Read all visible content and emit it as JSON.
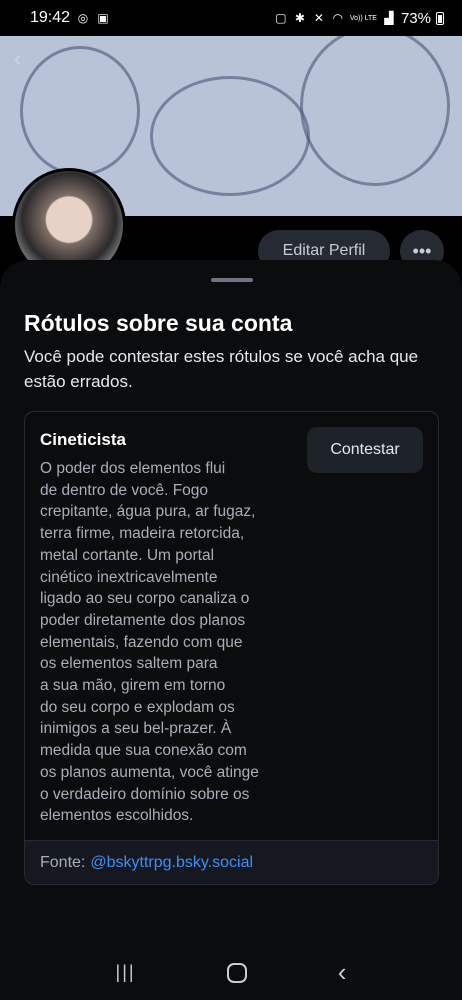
{
  "status_bar": {
    "time": "19:42",
    "icons_left": [
      "whatsapp-icon",
      "gallery-icon"
    ],
    "icons_right": [
      "nfc-icon",
      "bluetooth-icon",
      "mute-icon",
      "wifi-icon",
      "volte-icon",
      "signal-icon"
    ],
    "volte_label": "Vo)) LTE",
    "battery": "73%"
  },
  "profile": {
    "edit_button": "Editar Perfil",
    "more_icon": "•••"
  },
  "sheet": {
    "title": "Rótulos sobre sua conta",
    "subtitle": "Você pode contestar estes rótulos se você acha que estão errados.",
    "label": {
      "name": "Cineticista",
      "contest_button": "Contestar",
      "description": "O poder dos elementos flui\nde dentro de você. Fogo\ncrepitante, água pura, ar fugaz,\nterra firme, madeira retorcida,\nmetal cortante. Um portal\ncinético inextricavelmente\nligado ao seu corpo canaliza o\npoder diretamente dos planos\nelementais, fazendo com que\nos elementos saltem para\na sua mão, girem em torno\ndo seu corpo e explodam os\ninimigos a seu bel-prazer. À\nmedida que sua conexão com\nos planos aumenta, você atinge\no verdadeiro domínio sobre os\nelementos escolhidos.",
      "source_prefix": "Fonte:",
      "source_link": "@bskyttrpg.bsky.social"
    }
  },
  "navbar": {
    "recent": "|||",
    "back": "‹"
  },
  "colors": {
    "sheet_bg": "#0b0c0e",
    "link": "#3e8ff5",
    "banner": "#b8c3d8"
  }
}
